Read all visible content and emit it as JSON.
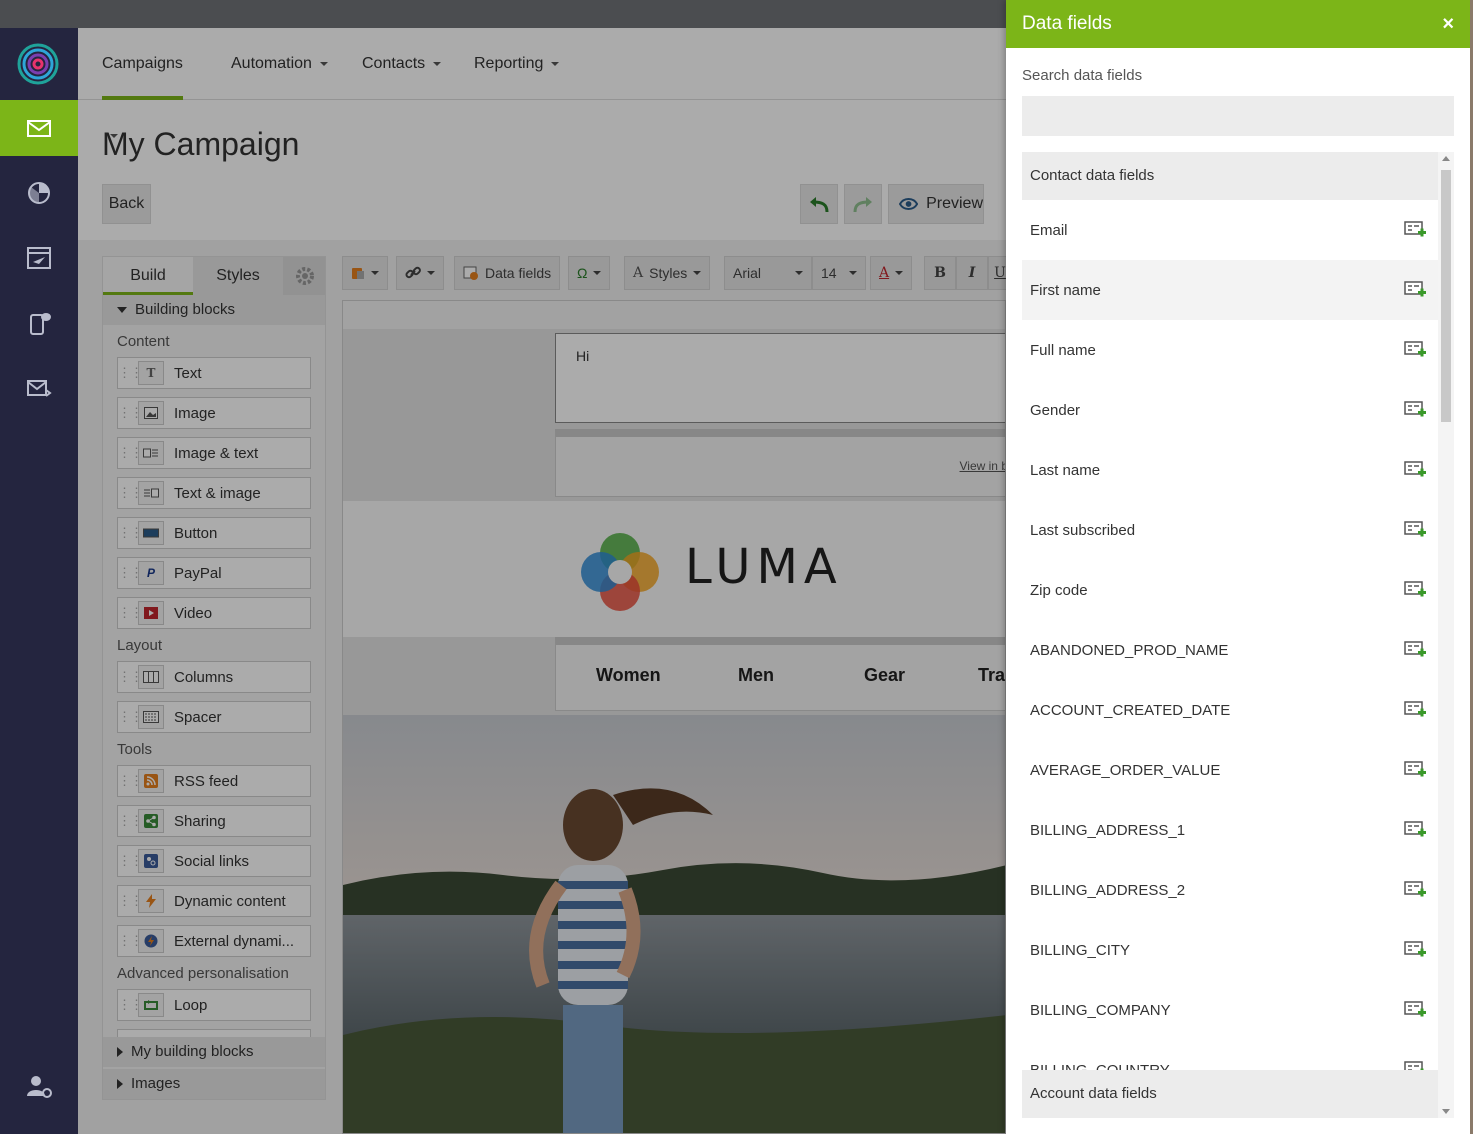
{
  "nav": {
    "campaigns": "Campaigns",
    "automation": "Automation",
    "contacts": "Contacts",
    "reporting": "Reporting"
  },
  "page": {
    "title": "My Campaign",
    "back": "Back",
    "preview": "Preview"
  },
  "panel": {
    "tab_build": "Build",
    "tab_styles": "Styles",
    "building_blocks": "Building blocks",
    "content_label": "Content",
    "layout_label": "Layout",
    "tools_label": "Tools",
    "advanced_label": "Advanced personalisation",
    "blocks": {
      "text": "Text",
      "image": "Image",
      "image_text": "Image & text",
      "text_image": "Text & image",
      "button": "Button",
      "paypal": "PayPal",
      "video": "Video",
      "columns": "Columns",
      "spacer": "Spacer",
      "rss": "RSS feed",
      "sharing": "Sharing",
      "social": "Social links",
      "dynamic": "Dynamic content",
      "external": "External dynami...",
      "loop": "Loop"
    },
    "my_blocks": "My building blocks",
    "images": "Images"
  },
  "toolbar": {
    "data_fields": "Data fields",
    "omega": "Ω",
    "styles": "Styles",
    "font": "Arial",
    "size": "14",
    "bold": "B",
    "italic": "I",
    "underline": "U",
    "color_glyph": "A",
    "styles_glyph": "A"
  },
  "canvas": {
    "greeting": "Hi",
    "view_link": "View in b",
    "logo_text": "LUMA",
    "menu": [
      "Women",
      "Men",
      "Gear",
      "Tra"
    ]
  },
  "drawer": {
    "title": "Data fields",
    "close": "×",
    "search_label": "Search data fields",
    "search_value": "",
    "contact_header": "Contact data fields",
    "account_header": "Account data fields",
    "fields": [
      "Email",
      "First name",
      "Full name",
      "Gender",
      "Last name",
      "Last subscribed",
      "Zip code",
      "ABANDONED_PROD_NAME",
      "ACCOUNT_CREATED_DATE",
      "AVERAGE_ORDER_VALUE",
      "BILLING_ADDRESS_1",
      "BILLING_ADDRESS_2",
      "BILLING_CITY",
      "BILLING_COMPANY",
      "BILLING_COUNTRY"
    ]
  },
  "colors": {
    "accent": "#7cb518",
    "rail": "#24253f"
  }
}
